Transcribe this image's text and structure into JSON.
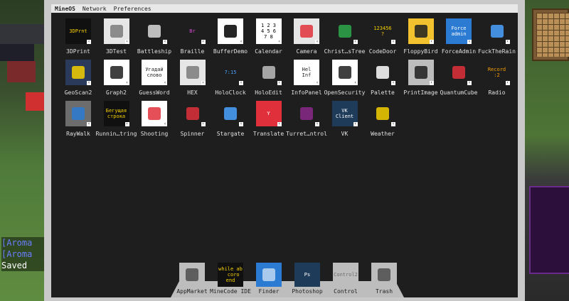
{
  "chat": {
    "lines": [
      "[Aroma",
      "[Aroma",
      "Saved"
    ]
  },
  "menubar": {
    "items": [
      "MineOS",
      "Network",
      "Preferences"
    ]
  },
  "apps": [
    {
      "label": "3DPrint",
      "icon": "3dprint-icon",
      "tile_text": "3DPrnt",
      "bg": "#101010",
      "fg": "#f5d000"
    },
    {
      "label": "3DTest",
      "icon": "cube-icon",
      "tile_text": "",
      "bg": "#e6e6e6",
      "fg": "#7a7a7a"
    },
    {
      "label": "Battleship",
      "icon": "battleship-icon",
      "tile_text": "",
      "bg": "#1e1e1e",
      "fg": "#d9d9d9"
    },
    {
      "label": "Braille",
      "icon": "braille-icon",
      "tile_text": "Br",
      "bg": "#1e1e1e",
      "fg": "#d24bd2"
    },
    {
      "label": "BufferDemo",
      "icon": "color-bars-icon",
      "tile_text": "",
      "bg": "#ffffff",
      "fg": "#000000"
    },
    {
      "label": "Calendar",
      "icon": "calendar-icon",
      "tile_text": "1 2 3\n4 5 6\n7 8",
      "bg": "#ffffff",
      "fg": "#000000"
    },
    {
      "label": "Camera",
      "icon": "camera-icon",
      "tile_text": "",
      "bg": "#e6e6e6",
      "fg": "#e0303b"
    },
    {
      "label": "Christ…sTree",
      "icon": "christmas-tree-icon",
      "tile_text": "",
      "bg": "#1e1e1e",
      "fg": "#2ea84b"
    },
    {
      "label": "CodeDoor",
      "icon": "codedoor-icon",
      "tile_text": "123456\n?",
      "bg": "#1e1e1e",
      "fg": "#f5d000"
    },
    {
      "label": "FloppyBird",
      "icon": "floppybird-icon",
      "tile_text": "",
      "bg": "#f2c12e",
      "fg": "#1e1e1e"
    },
    {
      "label": "ForceAdmin",
      "icon": "forceadmin-icon",
      "tile_text": "Force\nadmin",
      "bg": "#2c7bd3",
      "fg": "#ffffff"
    },
    {
      "label": "FuckTheRain",
      "icon": "rain-icon",
      "tile_text": "",
      "bg": "#1e1e1e",
      "fg": "#4aa3ff"
    },
    {
      "label": "GeoScan2",
      "icon": "geoscan-icon",
      "tile_text": "",
      "bg": "#2a3a5a",
      "fg": "#f5d000"
    },
    {
      "label": "Graph2",
      "icon": "graph-icon",
      "tile_text": "",
      "bg": "#ffffff",
      "fg": "#1e1e1e"
    },
    {
      "label": "GuessWord",
      "icon": "guessword-icon",
      "tile_text": "Угадай\nслово",
      "bg": "#ffffff",
      "fg": "#1e1e1e"
    },
    {
      "label": "HEX",
      "icon": "hex-icon",
      "tile_text": "",
      "bg": "#e6e6e6",
      "fg": "#7a7a7a"
    },
    {
      "label": "HoloClock",
      "icon": "holoclock-icon",
      "tile_text": "7:15",
      "bg": "#1e1e1e",
      "fg": "#4aa3ff"
    },
    {
      "label": "HoloEdit",
      "icon": "holoedit-icon",
      "tile_text": "",
      "bg": "#1e1e1e",
      "fg": "#bdbdbd"
    },
    {
      "label": "InfoPanel",
      "icon": "infopanel-icon",
      "tile_text": "Hel\nInf",
      "bg": "#ffffff",
      "fg": "#1e1e1e"
    },
    {
      "label": "OpenSecurity",
      "icon": "opensecurity-icon",
      "tile_text": "",
      "bg": "#ffffff",
      "fg": "#1e1e1e"
    },
    {
      "label": "Palette",
      "icon": "palette-icon",
      "tile_text": "",
      "bg": "#1e1e1e",
      "fg": "#ffffff"
    },
    {
      "label": "PrintImage",
      "icon": "printimage-icon",
      "tile_text": "",
      "bg": "#bdbdbd",
      "fg": "#1e1e1e"
    },
    {
      "label": "QuantumCube",
      "icon": "quantumcube-icon",
      "tile_text": "",
      "bg": "#1e1e1e",
      "fg": "#e0303b"
    },
    {
      "label": "Radio",
      "icon": "radio-icon",
      "tile_text": "Record\n:2",
      "bg": "#1e1e1e",
      "fg": "#f5a000"
    },
    {
      "label": "RayWalk",
      "icon": "raywalk-icon",
      "tile_text": "",
      "bg": "#6d6d6d",
      "fg": "#2c7bd3"
    },
    {
      "label": "Runnin…tring",
      "icon": "running-string-icon",
      "tile_text": "Бегущая\nстрока",
      "bg": "#101010",
      "fg": "#f5d000"
    },
    {
      "label": "Shooting",
      "icon": "shooting-icon",
      "tile_text": "",
      "bg": "#ffffff",
      "fg": "#e0303b"
    },
    {
      "label": "Spinner",
      "icon": "spinner-icon",
      "tile_text": "",
      "bg": "#1e1e1e",
      "fg": "#e0303b"
    },
    {
      "label": "Stargate",
      "icon": "stargate-icon",
      "tile_text": "",
      "bg": "#1e1e1e",
      "fg": "#4aa3ff"
    },
    {
      "label": "Translate",
      "icon": "translate-icon",
      "tile_text": "Y",
      "bg": "#e0303b",
      "fg": "#ffffff"
    },
    {
      "label": "Turret…ntrol",
      "icon": "turret-icon",
      "tile_text": "",
      "bg": "#1e1e1e",
      "fg": "#8a2a8a"
    },
    {
      "label": "VK",
      "icon": "vk-icon",
      "tile_text": "VK\nClient",
      "bg": "#1e3b5a",
      "fg": "#ffffff"
    },
    {
      "label": "Weather",
      "icon": "weather-icon",
      "tile_text": "",
      "bg": "#1e1e1e",
      "fg": "#f5d000"
    }
  ],
  "dock": [
    {
      "label": "AppMarket",
      "icon": "appmarket-icon",
      "tile_text": "",
      "bg": "#bdbdbd",
      "fg": "#1e1e1e"
    },
    {
      "label": "MineCode IDE",
      "icon": "minecode-icon",
      "tile_text": "while ab\n  coro\nend",
      "bg": "#101010",
      "fg": "#f5d000"
    },
    {
      "label": "Finder",
      "icon": "finder-icon",
      "tile_text": "",
      "bg": "#2c7bd3",
      "fg": "#ffffff"
    },
    {
      "label": "Photoshop",
      "icon": "photoshop-icon",
      "tile_text": "Ps",
      "bg": "#1e3b5a",
      "fg": "#ffffff"
    },
    {
      "label": "Control",
      "icon": "control-icon",
      "tile_text": "Control2",
      "bg": "#bdbdbd",
      "fg": "#6d6d6d"
    },
    {
      "label": "Trash",
      "icon": "trash-icon",
      "tile_text": "",
      "bg": "#bdbdbd",
      "fg": "#1e1e1e"
    }
  ]
}
